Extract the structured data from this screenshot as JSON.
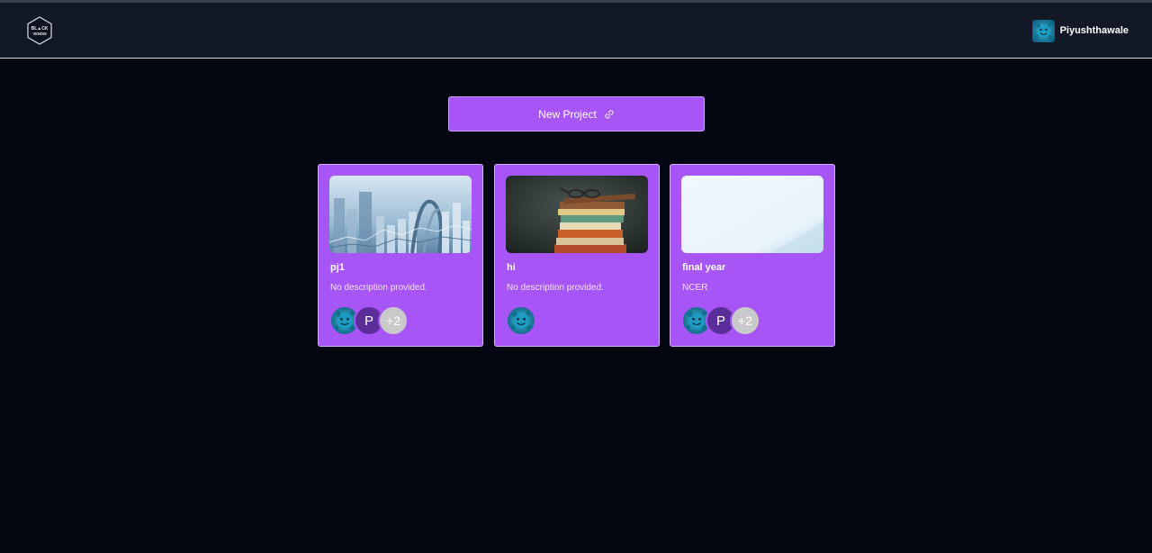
{
  "header": {
    "logo": {
      "icon": "black-venom-logo",
      "text": "BLACK VENOM"
    },
    "user": {
      "name": "Piyushthawale",
      "avatar_icon": "virus-avatar-icon"
    }
  },
  "new_project": {
    "label": "New Project",
    "icon": "link-icon"
  },
  "projects": [
    {
      "title": "pj1",
      "description": "No description provided.",
      "image": "finance-buildings-chart",
      "members": [
        {
          "type": "avatar",
          "icon": "virus-avatar-icon"
        },
        {
          "type": "letter",
          "text": "P"
        },
        {
          "type": "more",
          "text": "+2"
        }
      ]
    },
    {
      "title": "hi",
      "description": "No description provided.",
      "image": "stack-of-books-with-glasses",
      "members": [
        {
          "type": "avatar",
          "icon": "virus-avatar-icon"
        }
      ]
    },
    {
      "title": "final year",
      "description": "NCER",
      "image": "light-blue-blank",
      "members": [
        {
          "type": "avatar",
          "icon": "virus-avatar-icon"
        },
        {
          "type": "letter",
          "text": "P"
        },
        {
          "type": "more",
          "text": "+2"
        }
      ]
    }
  ],
  "colors": {
    "background": "#040611",
    "navbar": "#131826",
    "accent": "#a855f7",
    "member_letter_bg": "#5b2d9a",
    "member_more_bg": "#c9c9c9"
  }
}
